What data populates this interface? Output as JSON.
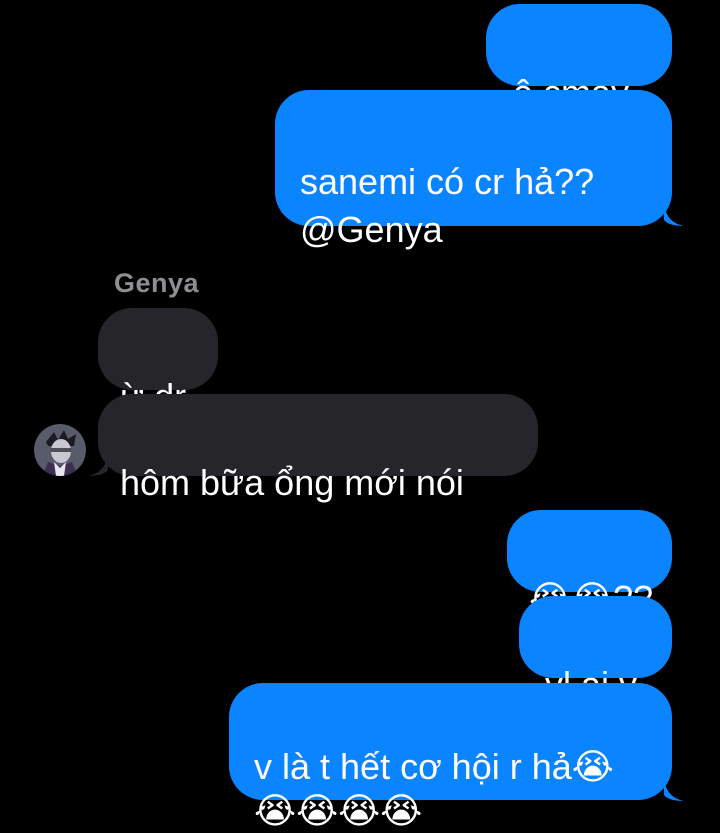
{
  "messages": [
    {
      "direction": "outgoing",
      "text": "ê cmay"
    },
    {
      "direction": "outgoing",
      "text": "sanemi có cr hả??\n@Genya"
    },
    {
      "sender": "Genya"
    },
    {
      "direction": "incoming",
      "text": "ừ dr"
    },
    {
      "direction": "incoming",
      "text": "hôm bữa ổng mới nói"
    },
    {
      "direction": "outgoing",
      "text": "😭😭??"
    },
    {
      "direction": "outgoing",
      "text": "vl ai v"
    },
    {
      "direction": "outgoing",
      "text": "v là t hết cơ hội r hả😭\n😭😭😭😭"
    }
  ],
  "colors": {
    "outgoing_bubble": "#0A84FF",
    "incoming_bubble": "#26252A",
    "background": "#000000",
    "sender_name": "#8E8E93"
  },
  "avatar_icon": "genya-avatar-icon"
}
